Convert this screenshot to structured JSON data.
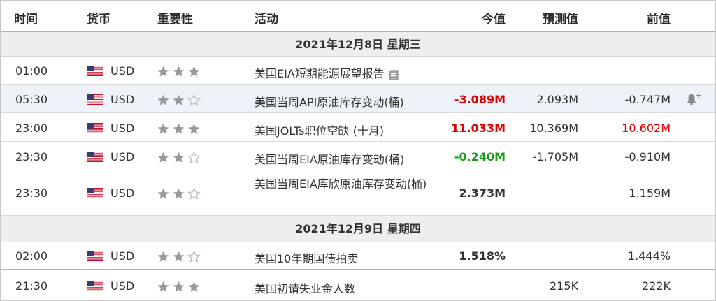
{
  "headers": {
    "time": "时间",
    "currency": "货币",
    "importance": "重要性",
    "event": "活动",
    "actual": "今值",
    "forecast": "预测值",
    "previous": "前值"
  },
  "dates": [
    "2021年12月8日  星期三",
    "2021年12月9日  星期四"
  ],
  "colors": {
    "red": "#e00000",
    "green": "#1a9e1a",
    "star_filled": "#999999",
    "star_empty": "#bbbbbb"
  },
  "events": [
    {
      "time": "01:00",
      "currency": "USD",
      "stars": 3,
      "event": "美国EIA短期能源展望报告",
      "actual": "",
      "forecast": "",
      "previous": "",
      "icon": "document-icon"
    },
    {
      "time": "05:30",
      "currency": "USD",
      "stars": 2,
      "event": "美国当周API原油库存变动(桶)",
      "actual": "-3.089M",
      "forecast": "2.093M",
      "previous": "-0.747M",
      "icon": "bell-plus-icon"
    },
    {
      "time": "23:00",
      "currency": "USD",
      "stars": 3,
      "event": "美国JOLTs职位空缺 (十月)",
      "actual": "11.033M",
      "forecast": "10.369M",
      "previous": "10.602M"
    },
    {
      "time": "23:30",
      "currency": "USD",
      "stars": 2,
      "event": "美国当周EIA原油库存变动(桶)",
      "actual": "-0.240M",
      "forecast": "-1.705M",
      "previous": "-0.910M"
    },
    {
      "time": "23:30",
      "currency": "USD",
      "stars": 2,
      "event": "美国当周EIA库欣原油库存变动(桶)",
      "actual": "2.373M",
      "forecast": "",
      "previous": "1.159M"
    },
    {
      "time": "02:00",
      "currency": "USD",
      "stars": 2,
      "event": "美国10年期国债拍卖",
      "actual": "1.518%",
      "forecast": "",
      "previous": "1.444%"
    },
    {
      "time": "21:30",
      "currency": "USD",
      "stars": 3,
      "event": "美国初请失业金人数",
      "actual": "",
      "forecast": "215K",
      "previous": "222K"
    }
  ]
}
